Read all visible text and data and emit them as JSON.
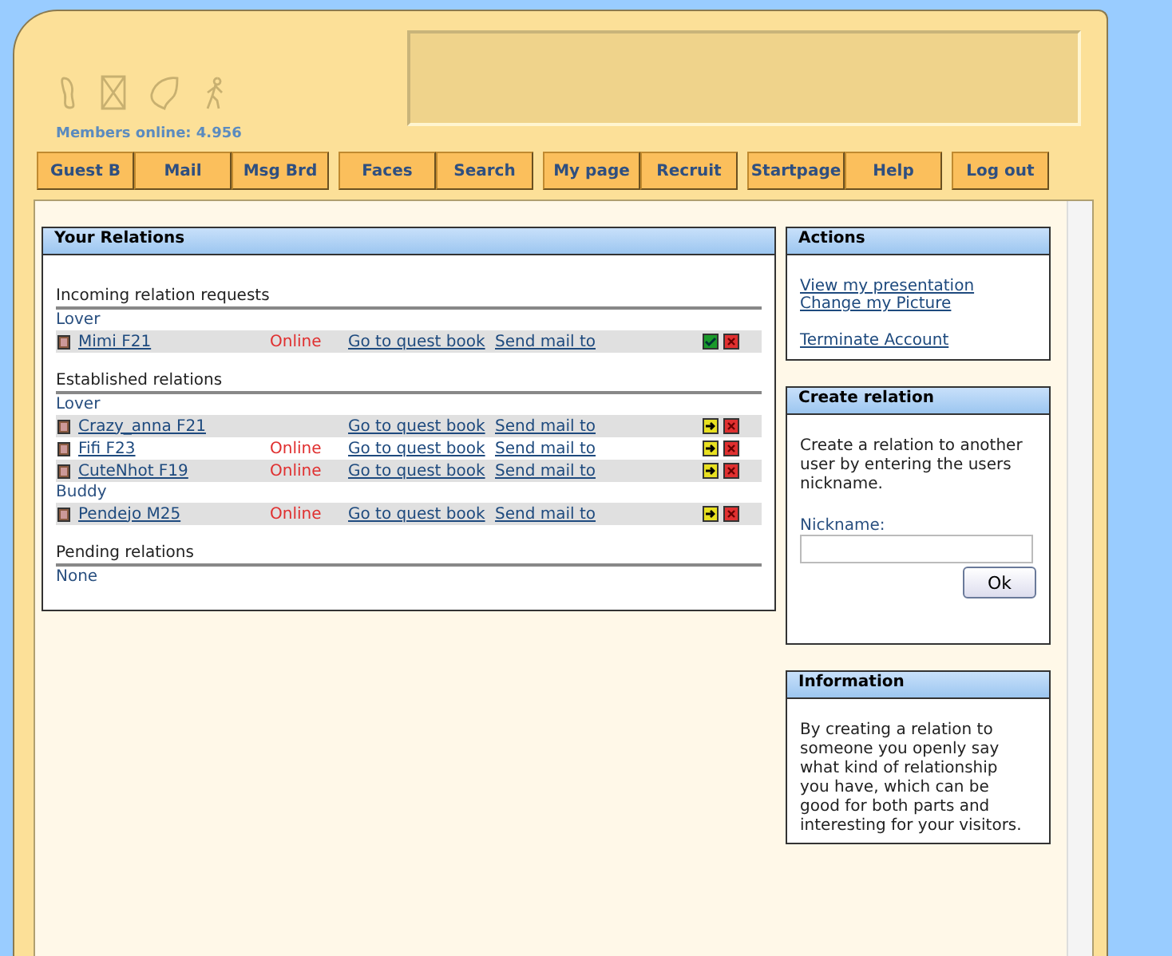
{
  "header": {
    "members_online": "Members online: 4.956"
  },
  "nav": [
    [
      "Guest B",
      "Mail",
      "Msg Brd"
    ],
    [
      "Faces",
      "Search"
    ],
    [
      "My page",
      "Recruit"
    ],
    [
      "Startpage",
      "Help"
    ],
    [
      "Log out"
    ]
  ],
  "relations": {
    "title": "Your Relations",
    "sections": [
      {
        "heading": "Incoming relation requests",
        "groups": [
          {
            "label": "Lover",
            "rows": [
              {
                "name": "Mimi F21",
                "status": "Online",
                "guestbook": "Go to quest book",
                "mail": "Send mail to",
                "kind": "request"
              }
            ]
          }
        ]
      },
      {
        "heading": "Established relations",
        "groups": [
          {
            "label": "Lover",
            "rows": [
              {
                "name": "Crazy_anna F21",
                "guestbook": "Go to quest book",
                "mail": "Send mail to",
                "kind": "established"
              },
              {
                "name": "Fifi F23",
                "status": "Online",
                "guestbook": "Go to quest book",
                "mail": "Send mail to",
                "kind": "established"
              },
              {
                "name": "CuteNhot F19",
                "status": "Online",
                "guestbook": "Go to quest book",
                "mail": "Send mail to",
                "kind": "established"
              }
            ]
          },
          {
            "label": "Buddy",
            "rows": [
              {
                "name": "Pendejo M25",
                "status": "Online",
                "guestbook": "Go to quest book",
                "mail": "Send mail to",
                "kind": "established"
              }
            ]
          }
        ]
      },
      {
        "heading": "Pending relations",
        "empty": "None"
      }
    ]
  },
  "actions": {
    "title": "Actions",
    "links": [
      [
        "View my presentation",
        "Change my Picture"
      ],
      [
        "Terminate Account"
      ]
    ]
  },
  "create": {
    "title": "Create relation",
    "text": "Create a relation to another user by entering the users nickname.",
    "label": "Nickname:",
    "button": "Ok"
  },
  "information": {
    "title": "Information",
    "text": "By creating a relation to someone you openly say what kind of relationship you have, which can be good for both parts and interesting for your visitors."
  }
}
